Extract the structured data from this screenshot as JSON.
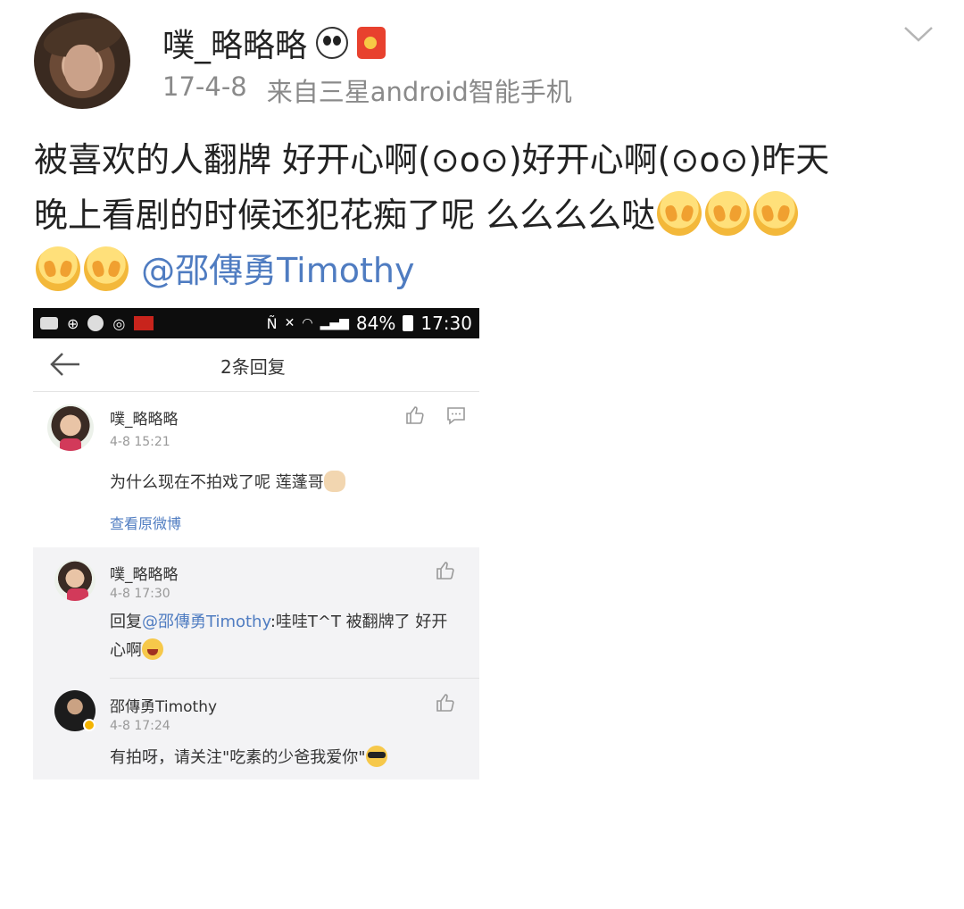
{
  "post": {
    "username": "噗_略略略",
    "date": "17-4-8",
    "source": "来自三星android智能手机",
    "text_line1": "被喜欢的人翻牌 好开心啊(⊙o⊙)好开心啊(⊙o⊙)昨天",
    "text_line2": "晚上看剧的时候还犯花痴了呢   么么么么哒",
    "mention": "@邵傳勇Timothy"
  },
  "screenshot": {
    "status_battery": "84%",
    "status_time": "17:30",
    "title": "2条回复",
    "comment": {
      "name": "噗_略略略",
      "time": "4-8 15:21",
      "body": "为什么现在不拍戏了呢 莲蓬哥",
      "link": "查看原微博"
    },
    "replies": [
      {
        "name": "噗_略略略",
        "time": "4-8 17:30",
        "body_prefix": "回复",
        "body_mention": "@邵傳勇Timothy",
        "body_line1_rest": ":哇哇T^T 被翻牌了 好开",
        "body_line2": "心啊"
      },
      {
        "name": "邵傳勇Timothy",
        "time": "4-8 17:24",
        "body": "有拍呀，请关注\"吃素的少爸我爱你\""
      }
    ]
  }
}
